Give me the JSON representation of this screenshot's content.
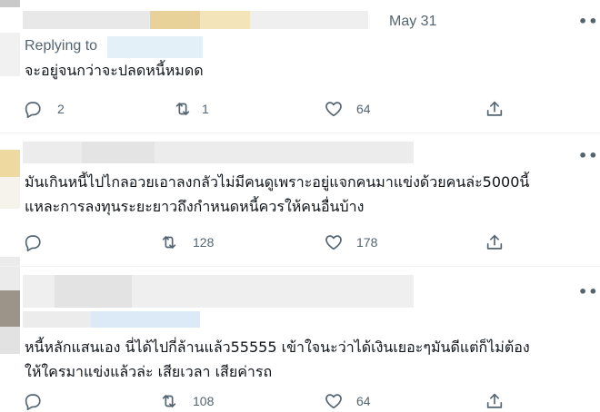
{
  "tweets": [
    {
      "date": "May 31",
      "replying_to": "Replying to",
      "text_lines": [
        "จะอยู่จนกว่าจะปลดหนี้หมดด"
      ],
      "replies": "2",
      "retweets": "1",
      "likes": "64"
    },
    {
      "text_lines": [
        "มันเกินหนี้ไปไกลอวยเอาลงกลัวไม่มีคนดูเพราะอยู่แจกคนมาแข่งด้วยคนล่ะ5000นี้",
        "แหละการลงทุนระยะยาวถึงกำหนดหนี้ควรให้คนอื่นบ้าง"
      ],
      "replies": "",
      "retweets": "128",
      "likes": "178"
    },
    {
      "text_lines": [
        "หนี้หลักแสนเอง นี่ได้ไปกี่ล้านแล้ว55555 เข้าใจนะว่าได้เงินเยอะๆมันดีแต่ก็ไม่ต้อง",
        "ให้ใครมาแข่งแล้วล่ะ เสียเวลา เสียค่ารถ"
      ],
      "replies": "",
      "retweets": "108",
      "likes": "64"
    }
  ],
  "more_label": "•••",
  "icons": {
    "reply": "reply-icon",
    "retweet": "retweet-icon",
    "like": "heart-icon",
    "share": "share-icon",
    "more": "more-icon"
  },
  "colors": {
    "meta": "#536471",
    "text": "#0f1419",
    "divider": "#eff3f4"
  }
}
